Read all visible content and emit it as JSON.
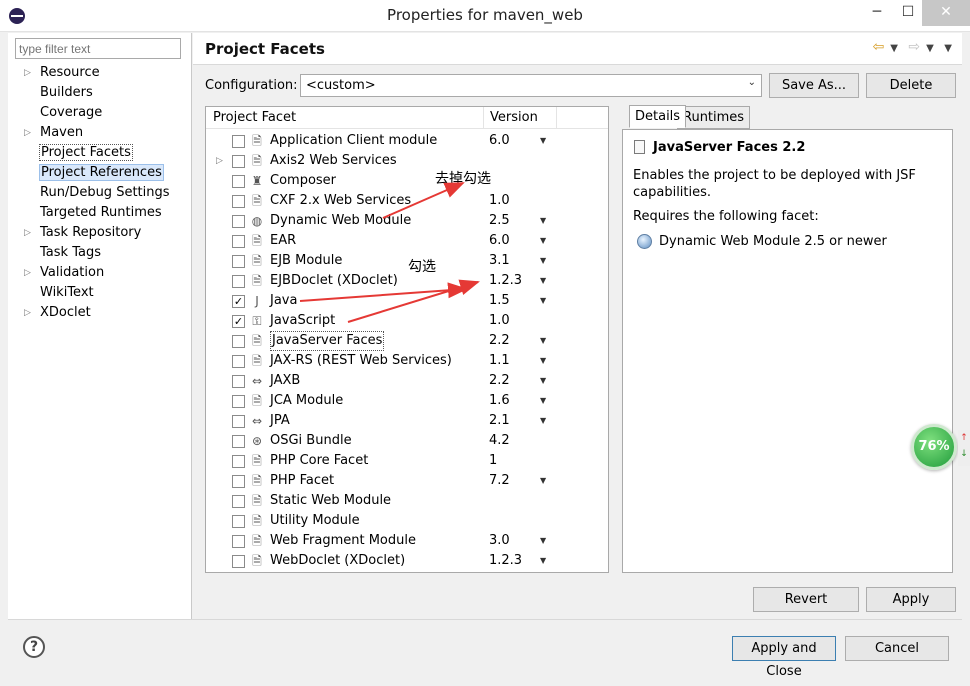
{
  "window": {
    "title": "Properties for maven_web",
    "min": "─",
    "max": "☐",
    "close": "✕"
  },
  "filter": {
    "placeholder": "type filter text"
  },
  "tree": [
    {
      "label": "Resource",
      "expandable": true
    },
    {
      "label": "Builders",
      "expandable": false
    },
    {
      "label": "Coverage",
      "expandable": false
    },
    {
      "label": "Maven",
      "expandable": true
    },
    {
      "label": "Project Facets",
      "expandable": false,
      "state": "focused"
    },
    {
      "label": "Project References",
      "expandable": false,
      "state": "highlighted"
    },
    {
      "label": "Run/Debug Settings",
      "expandable": false
    },
    {
      "label": "Targeted Runtimes",
      "expandable": false
    },
    {
      "label": "Task Repository",
      "expandable": true
    },
    {
      "label": "Task Tags",
      "expandable": false
    },
    {
      "label": "Validation",
      "expandable": true
    },
    {
      "label": "WikiText",
      "expandable": false
    },
    {
      "label": "XDoclet",
      "expandable": true
    }
  ],
  "page": {
    "title": "Project Facets"
  },
  "config": {
    "label": "Configuration:",
    "value": "<custom>",
    "save_as": "Save As...",
    "delete": "Delete"
  },
  "facets_table": {
    "col_facet": "Project Facet",
    "col_version": "Version",
    "rows": [
      {
        "name": "Application Client module",
        "version": "6.0",
        "checked": false,
        "dropdown": true,
        "icon": "doc-icon"
      },
      {
        "name": "Axis2 Web Services",
        "version": "",
        "checked": false,
        "dropdown": false,
        "icon": "doc-icon",
        "expandable": true
      },
      {
        "name": "Composer",
        "version": "",
        "checked": false,
        "dropdown": false,
        "icon": "composer-icon"
      },
      {
        "name": "CXF 2.x Web Services",
        "version": "1.0",
        "checked": false,
        "dropdown": false,
        "icon": "doc-icon"
      },
      {
        "name": "Dynamic Web Module",
        "version": "2.5",
        "checked": false,
        "dropdown": true,
        "icon": "web-module-icon"
      },
      {
        "name": "EAR",
        "version": "6.0",
        "checked": false,
        "dropdown": true,
        "icon": "doc-icon"
      },
      {
        "name": "EJB Module",
        "version": "3.1",
        "checked": false,
        "dropdown": true,
        "icon": "doc-icon"
      },
      {
        "name": "EJBDoclet (XDoclet)",
        "version": "1.2.3",
        "checked": false,
        "dropdown": true,
        "icon": "doc-icon"
      },
      {
        "name": "Java",
        "version": "1.5",
        "checked": true,
        "dropdown": true,
        "icon": "java-icon"
      },
      {
        "name": "JavaScript",
        "version": "1.0",
        "checked": true,
        "dropdown": false,
        "icon": "javascript-icon"
      },
      {
        "name": "JavaServer Faces",
        "version": "2.2",
        "checked": false,
        "dropdown": true,
        "icon": "doc-icon",
        "focused": true
      },
      {
        "name": "JAX-RS (REST Web Services)",
        "version": "1.1",
        "checked": false,
        "dropdown": true,
        "icon": "doc-icon"
      },
      {
        "name": "JAXB",
        "version": "2.2",
        "checked": false,
        "dropdown": true,
        "icon": "jaxb-icon"
      },
      {
        "name": "JCA Module",
        "version": "1.6",
        "checked": false,
        "dropdown": true,
        "icon": "doc-icon"
      },
      {
        "name": "JPA",
        "version": "2.1",
        "checked": false,
        "dropdown": true,
        "icon": "jpa-icon"
      },
      {
        "name": "OSGi Bundle",
        "version": "4.2",
        "checked": false,
        "dropdown": false,
        "icon": "osgi-icon"
      },
      {
        "name": "PHP Core Facet",
        "version": "1",
        "checked": false,
        "dropdown": false,
        "icon": "doc-icon"
      },
      {
        "name": "PHP Facet",
        "version": "7.2",
        "checked": false,
        "dropdown": true,
        "icon": "doc-icon"
      },
      {
        "name": "Static Web Module",
        "version": "",
        "checked": false,
        "dropdown": false,
        "icon": "doc-icon"
      },
      {
        "name": "Utility Module",
        "version": "",
        "checked": false,
        "dropdown": false,
        "icon": "doc-icon"
      },
      {
        "name": "Web Fragment Module",
        "version": "3.0",
        "checked": false,
        "dropdown": true,
        "icon": "doc-icon"
      },
      {
        "name": "WebDoclet (XDoclet)",
        "version": "1.2.3",
        "checked": false,
        "dropdown": true,
        "icon": "doc-icon"
      }
    ]
  },
  "details": {
    "tab_details": "Details",
    "tab_runtimes": "Runtimes",
    "title": "JavaServer Faces 2.2",
    "description": "Enables the project to be deployed with JSF capabilities.",
    "requires_label": "Requires the following facet:",
    "requires_item": "Dynamic Web Module 2.5 or newer"
  },
  "buttons": {
    "revert": "Revert",
    "apply": "Apply",
    "apply_close": "Apply and Close",
    "cancel": "Cancel",
    "help": "?"
  },
  "annotations": {
    "remove_check": "去掉勾选",
    "check": "勾选",
    "color": "#e53935"
  },
  "badge": {
    "percent": "76%"
  }
}
